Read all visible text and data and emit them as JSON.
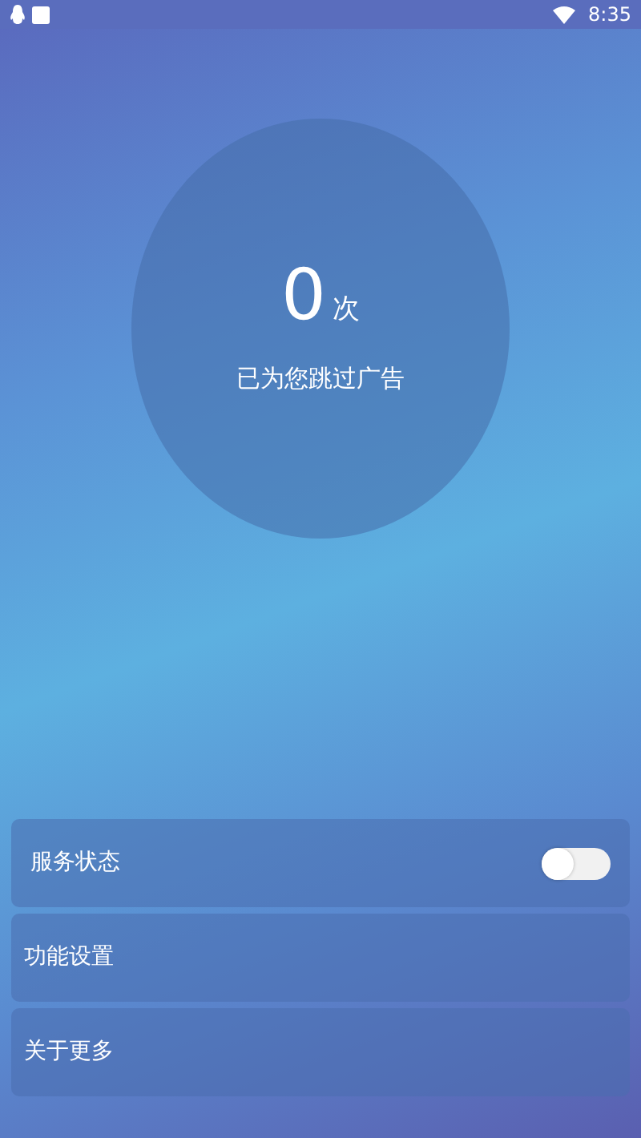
{
  "status_bar": {
    "time": "8:35"
  },
  "counter": {
    "value": "0",
    "unit": "次",
    "caption": "已为您跳过广告"
  },
  "menu": [
    {
      "kind": "toggle",
      "label": "服务状态",
      "on": false
    },
    {
      "kind": "link",
      "label": "功能设置"
    },
    {
      "kind": "link",
      "label": "关于更多"
    }
  ]
}
